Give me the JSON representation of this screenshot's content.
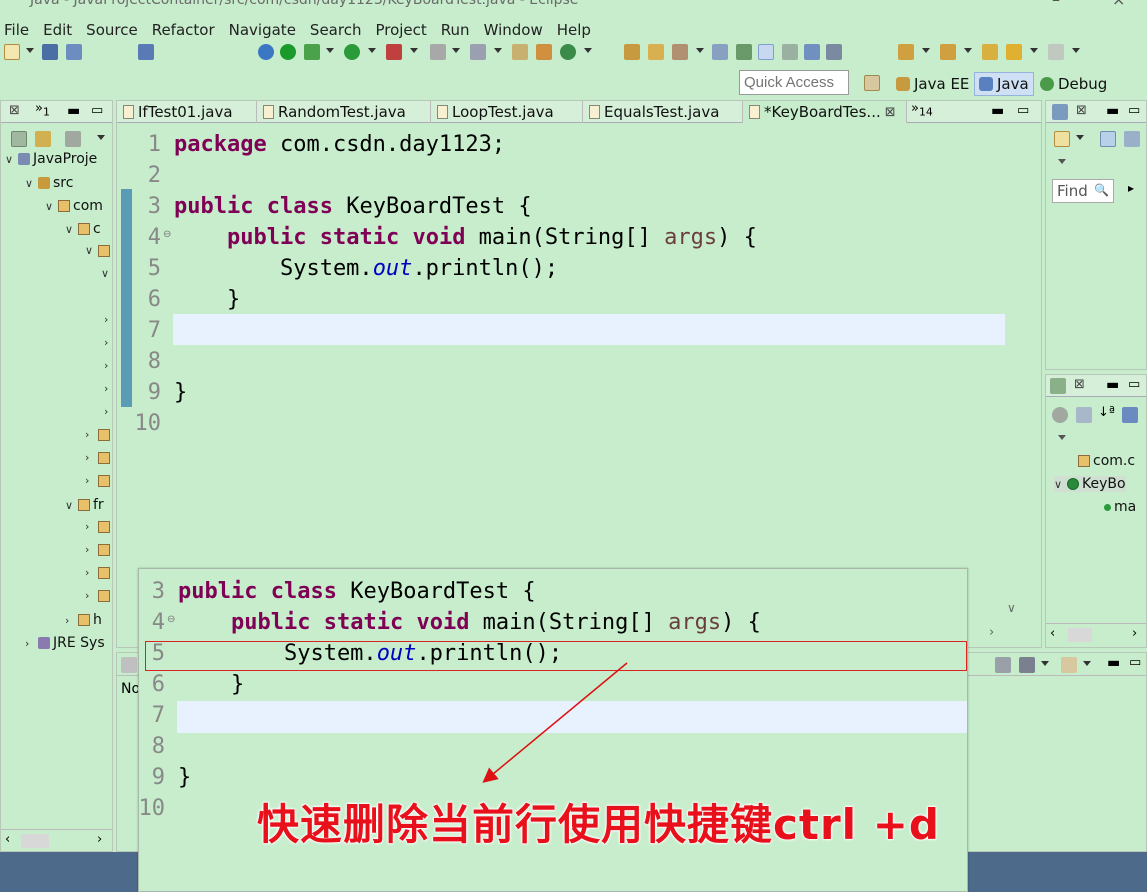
{
  "window": {
    "title": "Java - JavaProjectContainer/src/com/csdn/day1123/KeyBoardTest.java - Eclipse"
  },
  "menu": [
    "File",
    "Edit",
    "Source",
    "Refactor",
    "Navigate",
    "Search",
    "Project",
    "Run",
    "Window",
    "Help"
  ],
  "quick_access": {
    "placeholder": "Quick Access"
  },
  "perspectives": [
    {
      "label": "Java EE",
      "active": false
    },
    {
      "label": "Java",
      "active": true
    },
    {
      "label": "Debug",
      "active": false
    }
  ],
  "package_explorer": {
    "overflow_count": "1",
    "tree": [
      {
        "label": "JavaProje",
        "depth": 0
      },
      {
        "label": "src",
        "depth": 1
      },
      {
        "label": "com",
        "depth": 2
      },
      {
        "label": "c",
        "depth": 3
      },
      {
        "label": "fr",
        "depth": 3
      },
      {
        "label": "h",
        "depth": 3
      },
      {
        "label": "JRE Sys",
        "depth": 1
      }
    ]
  },
  "editor": {
    "tabs": [
      {
        "label": "IfTest01.java",
        "active": false
      },
      {
        "label": "RandomTest.java",
        "active": false
      },
      {
        "label": "LoopTest.java",
        "active": false
      },
      {
        "label": "EqualsTest.java",
        "active": false
      },
      {
        "label": "*KeyBoardTes...",
        "active": true
      }
    ],
    "overflow_count": "14",
    "current_line": 7,
    "lines": [
      {
        "n": "1",
        "text": "package com.csdn.day1123;"
      },
      {
        "n": "2",
        "text": ""
      },
      {
        "n": "3",
        "text": "public class KeyBoardTest {"
      },
      {
        "n": "4",
        "text": "    public static void main(String[] args) {"
      },
      {
        "n": "5",
        "text": "        System.out.println();"
      },
      {
        "n": "6",
        "text": "    }"
      },
      {
        "n": "7",
        "text": ""
      },
      {
        "n": "8",
        "text": ""
      },
      {
        "n": "9",
        "text": "}"
      },
      {
        "n": "10",
        "text": ""
      }
    ]
  },
  "right_top": {
    "find_placeholder": "Find"
  },
  "outline": {
    "items": [
      {
        "label": "com.c"
      },
      {
        "label": "KeyBo"
      },
      {
        "label": "ma"
      }
    ]
  },
  "bottom": {
    "tab_label": "No"
  },
  "overlay": {
    "lines": [
      {
        "n": "3",
        "text": "public class KeyBoardTest {"
      },
      {
        "n": "4",
        "text": "    public static void main(String[] args) {"
      },
      {
        "n": "5",
        "text": "        System.out.println();"
      },
      {
        "n": "6",
        "text": "    }"
      },
      {
        "n": "7",
        "text": ""
      },
      {
        "n": "8",
        "text": ""
      },
      {
        "n": "9",
        "text": "}"
      },
      {
        "n": "10",
        "text": ""
      }
    ],
    "annotation": "快速删除当前行使用快捷键ctrl +d",
    "annotation_color": "#e8101a"
  },
  "colors": {
    "background": "#c7edcc",
    "keyword": "#7f0055",
    "field": "#0000c0",
    "current_line": "#e8f2fe"
  }
}
